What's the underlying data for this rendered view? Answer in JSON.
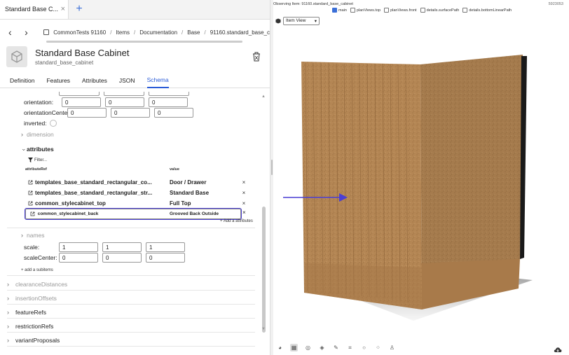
{
  "tab": {
    "title": "Standard Base C...",
    "close": "×",
    "new": "+"
  },
  "nav": {
    "back": "‹",
    "forward": "›",
    "crumbs": [
      "CommonTests 91160",
      "Items",
      "Documentation",
      "Base",
      "91160.standard_base_c"
    ]
  },
  "header": {
    "title": "Standard Base Cabinet",
    "subtitle": "standard_base_cabinet"
  },
  "subtabs": [
    "Definition",
    "Features",
    "Attributes",
    "JSON",
    "Schema"
  ],
  "schema": {
    "orientation_label": "orientation:",
    "orientation": [
      "0",
      "0",
      "0"
    ],
    "orientation_center_label": "orientationCente",
    "orientation_center": [
      "0",
      "0",
      "0"
    ],
    "inverted_label": "inverted:",
    "dimension": "dimension",
    "attributes": "attributes",
    "filter": "Filter...",
    "col_ref": "attributeRef",
    "col_value": "value",
    "rows": [
      {
        "ref": "templates_base_standard_rectangular_co...",
        "value": "Door / Drawer",
        "del": "×"
      },
      {
        "ref": "templates_base_standard_rectangular_str...",
        "value": "Standard Base",
        "del": "×"
      },
      {
        "ref": "common_stylecabinet_top",
        "value": "Full Top",
        "del": "×"
      },
      {
        "ref": "common_stylecabinet_back",
        "value": "Grooved Back Outside",
        "del": "×"
      }
    ],
    "add_attribute": "+ Add a attributes",
    "names": "names",
    "scale_label": "scale:",
    "scale": [
      "1",
      "1",
      "1"
    ],
    "scale_center_label": "scaleCenter:",
    "scale_center": [
      "0",
      "0",
      "0"
    ],
    "add_subitems": "+ add a subitems",
    "clearance": "clearanceDistances",
    "insertion": "insertionOffsets",
    "featureRefs": "featureRefs",
    "restrictionRefs": "restrictionRefs",
    "variantProposals": "variantProposals"
  },
  "viewer": {
    "observing": "Observing Item: 91160.standard_base_cabinet",
    "id": "5923053",
    "checks": [
      {
        "label": "main",
        "on": true
      },
      {
        "label": "planViews.top",
        "on": false
      },
      {
        "label": "planViews.front",
        "on": false
      },
      {
        "label": "details.surfacePath",
        "on": false
      },
      {
        "label": "details.bottomLinearPath",
        "on": false
      }
    ],
    "view_mode": "Item View",
    "tools": [
      "palette-icon",
      "grid-icon",
      "compass-icon",
      "layers-icon",
      "brush-icon",
      "frame-icon",
      "circle-icon",
      "dots-icon",
      "person-icon"
    ]
  },
  "colors": {
    "accent": "#2a5bd7",
    "selection": "#4a3fd4",
    "wood": "#b48654"
  }
}
